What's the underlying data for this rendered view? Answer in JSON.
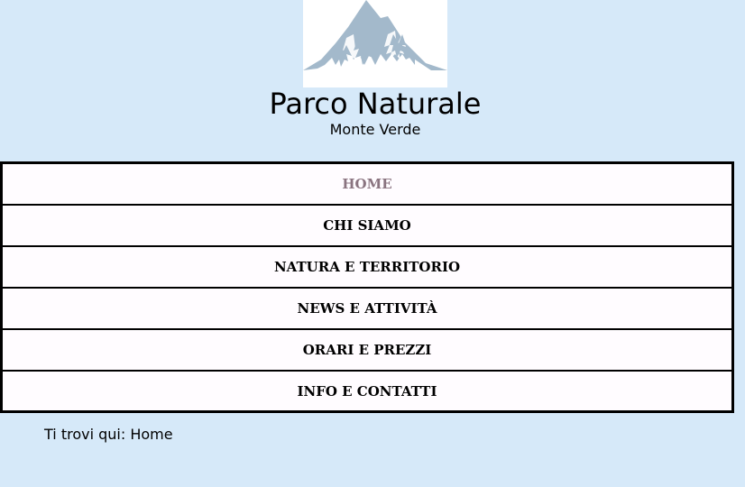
{
  "header": {
    "title": "Parco Naturale",
    "subtitle": "Monte Verde",
    "logo_icon": "mountain-trees-icon",
    "logo_color": "#a3b9cb"
  },
  "nav": {
    "items": [
      {
        "label": "HOME",
        "active": true
      },
      {
        "label": "CHI SIAMO",
        "active": false
      },
      {
        "label": "NATURA E TERRITORIO",
        "active": false
      },
      {
        "label": "NEWS E ATTIVITÀ",
        "active": false
      },
      {
        "label": "ORARI E PREZZI",
        "active": false
      },
      {
        "label": "INFO E CONTATTI",
        "active": false
      }
    ],
    "active_color": "#8a7480"
  },
  "breadcrumb": {
    "prefix": "Ti trovi qui: ",
    "current": "Home"
  },
  "colors": {
    "page_background": "#d6e9f9",
    "nav_background": "#fffcff"
  }
}
